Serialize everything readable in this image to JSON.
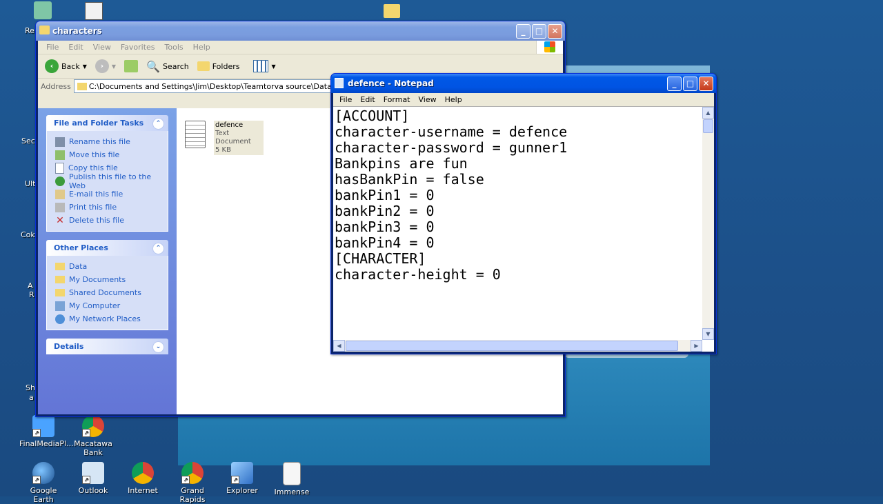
{
  "desktop": {
    "icons": [
      {
        "label": "FinalMediaPl...",
        "icon": "media-player-icon"
      },
      {
        "label": "Macatawa Bank",
        "icon": "chrome-icon"
      },
      {
        "label": "Google Earth",
        "icon": "google-earth-icon"
      },
      {
        "label": "Outlook",
        "icon": "outlook-icon"
      },
      {
        "label": "Internet",
        "icon": "chrome-icon"
      },
      {
        "label": "Grand Rapids",
        "icon": "chrome-icon"
      },
      {
        "label": "Explorer",
        "icon": "explorer-icon"
      },
      {
        "label": "Immense",
        "icon": "text-file-icon"
      }
    ],
    "edge_labels": [
      "Re",
      "Sec",
      "Ult",
      "Cok",
      "A",
      "R",
      "Sh",
      "a"
    ]
  },
  "explorer": {
    "title": "characters",
    "menu": [
      "File",
      "Edit",
      "View",
      "Favorites",
      "Tools",
      "Help"
    ],
    "toolbar": {
      "back": "Back",
      "search": "Search",
      "folders": "Folders"
    },
    "address_label": "Address",
    "address_value": "C:\\Documents and Settings\\Jim\\Desktop\\Teamtorva source\\Data\\characters",
    "file_tasks": {
      "title": "File and Folder Tasks",
      "items": [
        "Rename this file",
        "Move this file",
        "Copy this file",
        "Publish this file to the Web",
        "E-mail this file",
        "Print this file",
        "Delete this file"
      ]
    },
    "other_places": {
      "title": "Other Places",
      "items": [
        "Data",
        "My Documents",
        "Shared Documents",
        "My Computer",
        "My Network Places"
      ]
    },
    "details": {
      "title": "Details"
    },
    "file": {
      "name": "defence",
      "type": "Text Document",
      "size": "5 KB"
    }
  },
  "notepad": {
    "title": "defence - Notepad",
    "menu": [
      "File",
      "Edit",
      "Format",
      "View",
      "Help"
    ],
    "lines": [
      "[ACCOUNT]",
      "character-username = defence",
      "character-password = gunner1",
      "",
      "",
      "",
      "Bankpins are fun",
      "hasBankPin = false",
      "bankPin1 = 0",
      "bankPin2 = 0",
      "bankPin3 = 0",
      "bankPin4 = 0",
      "[CHARACTER]",
      "character-height = 0"
    ]
  }
}
